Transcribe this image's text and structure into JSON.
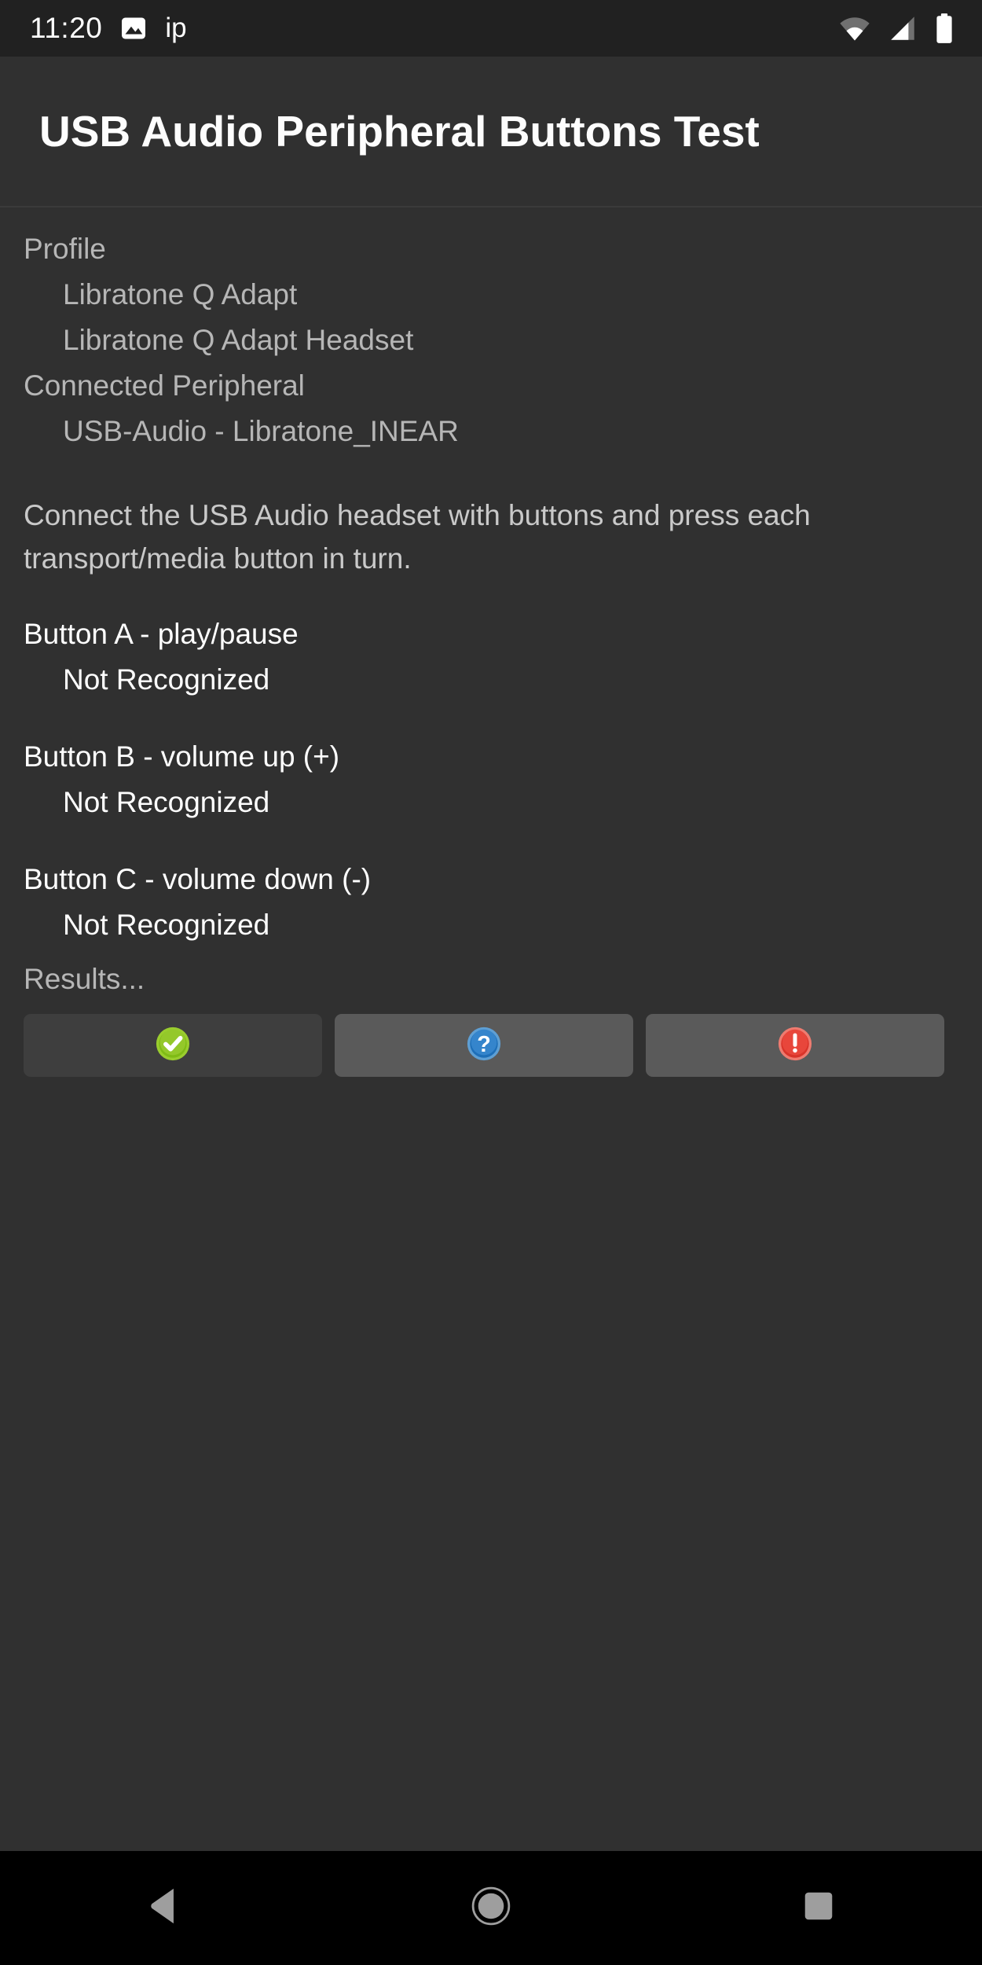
{
  "statusbar": {
    "clock": "11:20",
    "photo_icon": "image-icon",
    "label": "ip",
    "wifi_icon": "wifi-icon",
    "signal_icon": "cellular-signal-icon",
    "battery_icon": "battery-full-icon"
  },
  "header": {
    "title": "USB Audio Peripheral Buttons Test"
  },
  "profile": {
    "heading": "Profile",
    "items": [
      "Libratone Q Adapt",
      "Libratone Q Adapt Headset"
    ]
  },
  "peripheral": {
    "heading": "Connected Peripheral",
    "value": "USB-Audio - Libratone_INEAR"
  },
  "instructions": "Connect the USB Audio headset with buttons and press each transport/media button in turn.",
  "tests": [
    {
      "label": "Button A - play/pause",
      "status": "Not Recognized"
    },
    {
      "label": "Button B - volume up (+)",
      "status": "Not Recognized"
    },
    {
      "label": "Button C - volume down (-)",
      "status": "Not Recognized"
    }
  ],
  "results": {
    "label": "Results...",
    "buttons": [
      {
        "name": "pass-button",
        "icon": "check-circle-icon",
        "color": "#8BC220",
        "state": "selected"
      },
      {
        "name": "info-button",
        "icon": "question-circle-icon",
        "color": "#2E7FC4",
        "state": "normal"
      },
      {
        "name": "fail-button",
        "icon": "exclamation-circle-icon",
        "color": "#E8453C",
        "state": "normal"
      }
    ]
  },
  "navbar": {
    "back": "back-triangle-icon",
    "home": "home-circle-icon",
    "recents": "recents-square-icon"
  }
}
